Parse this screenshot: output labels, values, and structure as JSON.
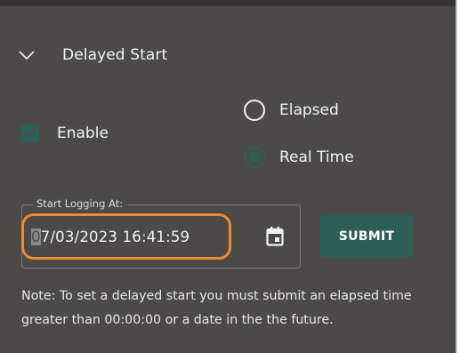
{
  "colors": {
    "panel_bg": "#4b4a48",
    "accent": "#2b5f55",
    "highlight": "#f08a2e",
    "text": "#f3f3f3"
  },
  "delayed_start": {
    "title": "Delayed Start",
    "expanded": true,
    "expand_icon": "chevron-down-icon",
    "enable": {
      "label": "Enable",
      "checked": true
    },
    "mode_options": [
      {
        "label": "Elapsed",
        "selected": false
      },
      {
        "label": "Real Time",
        "selected": true
      }
    ],
    "start_field": {
      "label": "Start Logging At:",
      "selected_text": "0",
      "value_rest": "7/03/2023 16:41:59",
      "icon": "calendar-icon"
    },
    "submit_label": "SUBMIT",
    "note": "Note: To set a delayed start you must submit an elapsed time greater than 00:00:00 or a date in the the future."
  }
}
